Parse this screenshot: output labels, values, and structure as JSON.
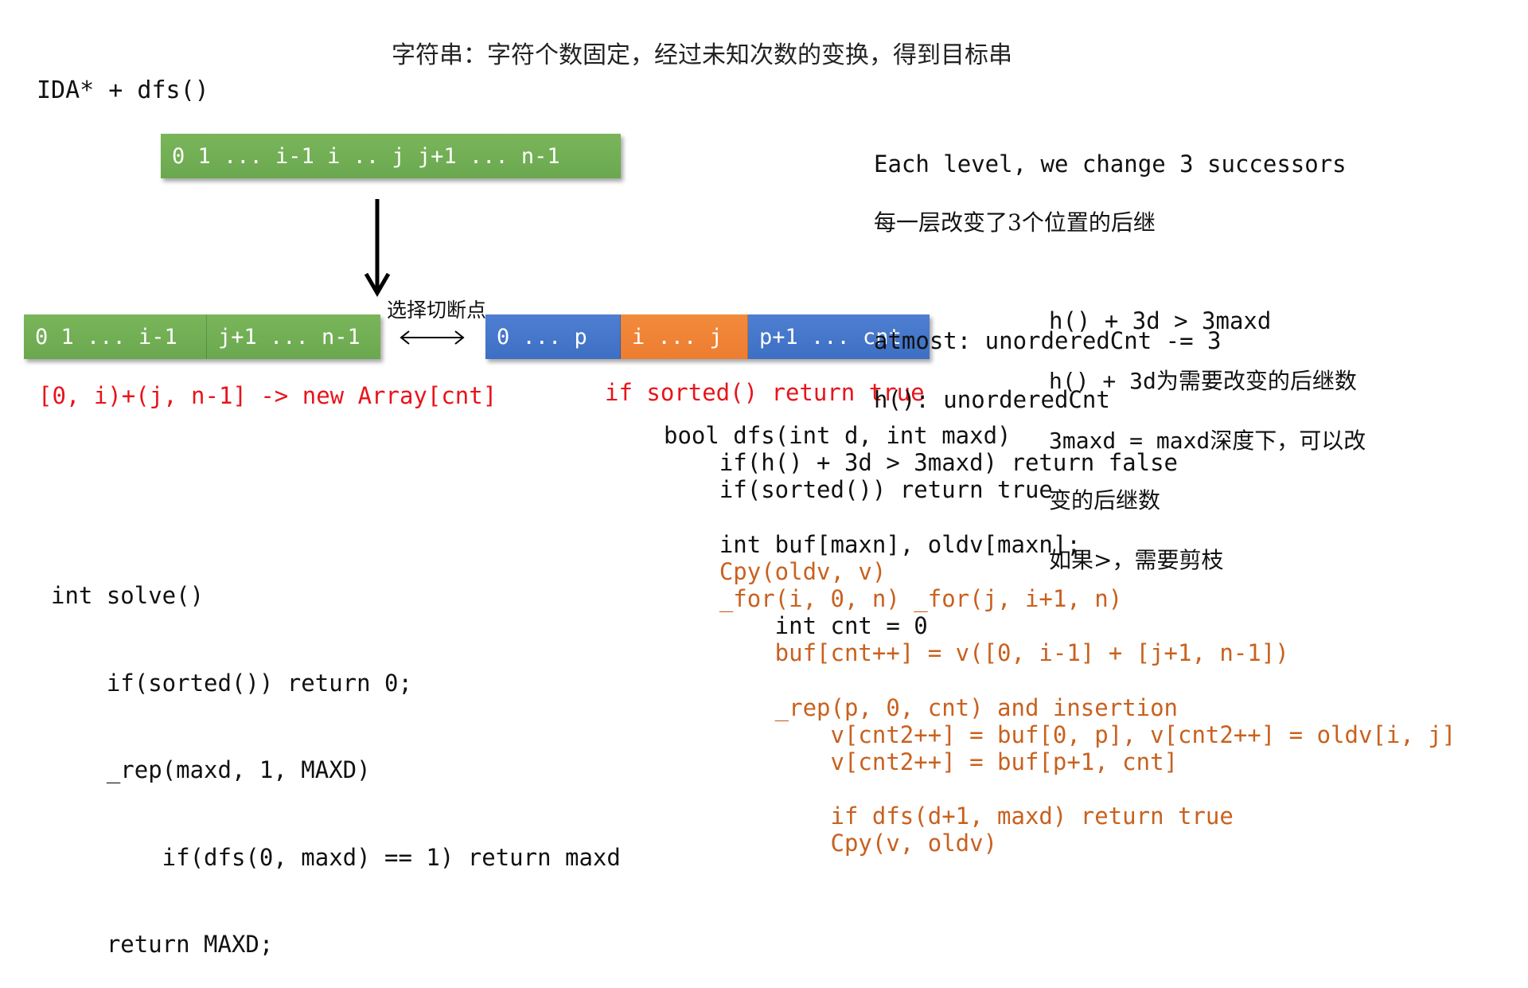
{
  "title": "字符串：字符个数固定，经过未知次数的变换，得到目标串",
  "heading": "IDA* + dfs()",
  "top_bar": {
    "label": "0 1 ... i-1 i .. j j+1 ... n-1",
    "color": "#70ad47"
  },
  "arrow_down": "down-arrow",
  "cut_label": "选择切断点",
  "left_bar": {
    "segments": [
      "0 1 ... i-1",
      "j+1 ... n-1"
    ],
    "color": "#70ad47"
  },
  "right_bar": {
    "segments": [
      {
        "label": "0 ... p",
        "color": "#4472c4"
      },
      {
        "label": "i ... j",
        "color": "#ed7d31"
      },
      {
        "label": "p+1 ... cnt",
        "color": "#4472c4"
      }
    ]
  },
  "left_caption": "[0, i)+(j, n-1] -> new Array[cnt]",
  "right_caption": "if sorted() return true",
  "notes_top": [
    "Each level, we change 3 successors",
    "每一层改变了3个位置的后继",
    "",
    "atmost: unorderedCnt -= 3",
    "h(): unorderedCnt"
  ],
  "notes_prune": [
    "h() + 3d > 3maxd",
    "h() + 3d为需要改变的后继数",
    "3maxd = maxd深度下，可以改",
    "变的后继数",
    "如果>，需要剪枝"
  ],
  "solve_code": [
    "int solve()",
    "    if(sorted()) return 0;",
    "    _rep(maxd, 1, MAXD)",
    "        if(dfs(0, maxd) == 1) return maxd",
    "    return MAXD;"
  ],
  "dfs_code": [
    {
      "text": "bool dfs(int d, int maxd)",
      "color": "black"
    },
    {
      "text": "    if(h() + 3d > 3maxd) return false",
      "color": "black"
    },
    {
      "text": "    if(sorted()) return true",
      "color": "black"
    },
    {
      "text": "",
      "color": "black"
    },
    {
      "text": "    int buf[maxn], oldv[maxn];",
      "color": "black"
    },
    {
      "text": "    Cpy(oldv, v)",
      "color": "orange"
    },
    {
      "text": "    _for(i, 0, n) _for(j, i+1, n)",
      "color": "orange"
    },
    {
      "text": "        int cnt = 0",
      "color": "black"
    },
    {
      "text": "        buf[cnt++] = v([0, i-1] + [j+1, n-1])",
      "color": "orange"
    },
    {
      "text": "",
      "color": "black"
    },
    {
      "text": "        _rep(p, 0, cnt) and insertion",
      "color": "orange"
    },
    {
      "text": "            v[cnt2++] = buf[0, p], v[cnt2++] = oldv[i, j]",
      "color": "orange"
    },
    {
      "text": "            v[cnt2++] = buf[p+1, cnt]",
      "color": "orange"
    },
    {
      "text": "",
      "color": "black"
    },
    {
      "text": "            if dfs(d+1, maxd) return true",
      "color": "orange"
    },
    {
      "text": "            Cpy(v, oldv)",
      "color": "orange"
    }
  ],
  "colors": {
    "red": "#e8141b",
    "orange": "#c8611f",
    "green": "#70ad47",
    "blue": "#4472c4",
    "bar_orange": "#ed7d31"
  }
}
